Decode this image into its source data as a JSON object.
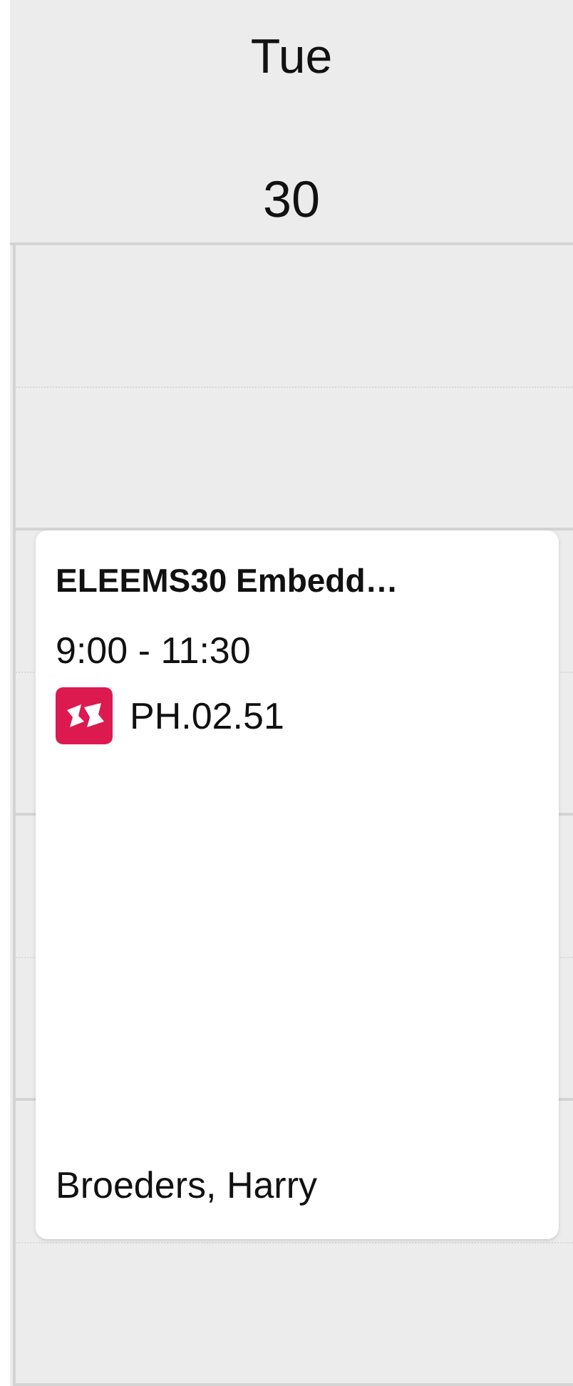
{
  "header": {
    "weekday": "Tue",
    "day": "30"
  },
  "event": {
    "title": "ELEEMS30 Embedd…",
    "time": "9:00 - 11:30",
    "location": "PH.02.51",
    "teacher": "Broeders, Harry"
  }
}
